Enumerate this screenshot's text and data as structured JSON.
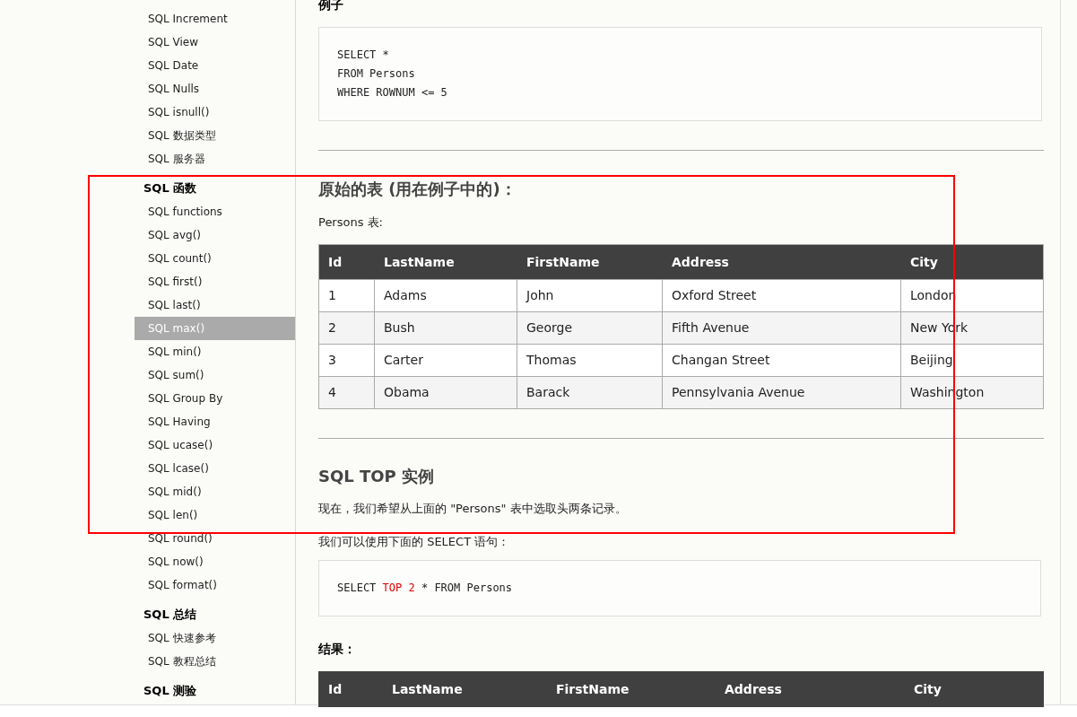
{
  "sidebar": {
    "groups": [
      {
        "items": [
          {
            "label": "SQL Increment",
            "selected": false
          },
          {
            "label": "SQL View",
            "selected": false
          },
          {
            "label": "SQL Date",
            "selected": false
          },
          {
            "label": "SQL Nulls",
            "selected": false
          },
          {
            "label": "SQL isnull()",
            "selected": false
          },
          {
            "label": "SQL 数据类型",
            "selected": false
          },
          {
            "label": "SQL 服务器",
            "selected": false
          }
        ]
      },
      {
        "title": "SQL 函数",
        "items": [
          {
            "label": "SQL functions",
            "selected": false
          },
          {
            "label": "SQL avg()",
            "selected": false
          },
          {
            "label": "SQL count()",
            "selected": false
          },
          {
            "label": "SQL first()",
            "selected": false
          },
          {
            "label": "SQL last()",
            "selected": false
          },
          {
            "label": "SQL max()",
            "selected": true
          },
          {
            "label": "SQL min()",
            "selected": false
          },
          {
            "label": "SQL sum()",
            "selected": false
          },
          {
            "label": "SQL Group By",
            "selected": false
          },
          {
            "label": "SQL Having",
            "selected": false
          },
          {
            "label": "SQL ucase()",
            "selected": false
          },
          {
            "label": "SQL lcase()",
            "selected": false
          },
          {
            "label": "SQL mid()",
            "selected": false
          },
          {
            "label": "SQL len()",
            "selected": false
          },
          {
            "label": "SQL round()",
            "selected": false
          },
          {
            "label": "SQL now()",
            "selected": false
          },
          {
            "label": "SQL format()",
            "selected": false
          }
        ]
      },
      {
        "title": "SQL 总结",
        "items": [
          {
            "label": "SQL 快速参考",
            "selected": false
          },
          {
            "label": "SQL 教程总结",
            "selected": false
          }
        ]
      },
      {
        "title": "SQL 测验"
      }
    ]
  },
  "content": {
    "example_heading": "例子",
    "example_code": [
      [
        {
          "text": "SELECT *",
          "highlight": false
        }
      ],
      [
        {
          "text": "FROM Persons",
          "highlight": false
        }
      ],
      [
        {
          "text": "WHERE ROWNUM <= 5",
          "highlight": false
        }
      ]
    ],
    "table_heading": "原始的表 (用在例子中的)：",
    "table_caption": "Persons 表:",
    "table": {
      "columns": [
        "Id",
        "LastName",
        "FirstName",
        "Address",
        "City"
      ],
      "rows": [
        [
          "1",
          "Adams",
          "John",
          "Oxford Street",
          "London"
        ],
        [
          "2",
          "Bush",
          "George",
          "Fifth Avenue",
          "New York"
        ],
        [
          "3",
          "Carter",
          "Thomas",
          "Changan Street",
          "Beijing"
        ],
        [
          "4",
          "Obama",
          "Barack",
          "Pennsylvania Avenue",
          "Washington"
        ]
      ]
    },
    "section_heading": "SQL TOP 实例",
    "paragraph_1": "现在，我们希望从上面的 \"Persons\" 表中选取头两条记录。",
    "paragraph_2": "我们可以使用下面的 SELECT 语句：",
    "top_code": [
      [
        {
          "text": "SELECT ",
          "highlight": false
        },
        {
          "text": "TOP 2",
          "highlight": true
        },
        {
          "text": " * FROM Persons",
          "highlight": false
        }
      ]
    ],
    "result_heading": "结果：",
    "result_table": {
      "columns": [
        "Id",
        "LastName",
        "FirstName",
        "Address",
        "City"
      ]
    }
  },
  "annotation": {
    "kind": "rectangle",
    "color": "#ff0000"
  }
}
